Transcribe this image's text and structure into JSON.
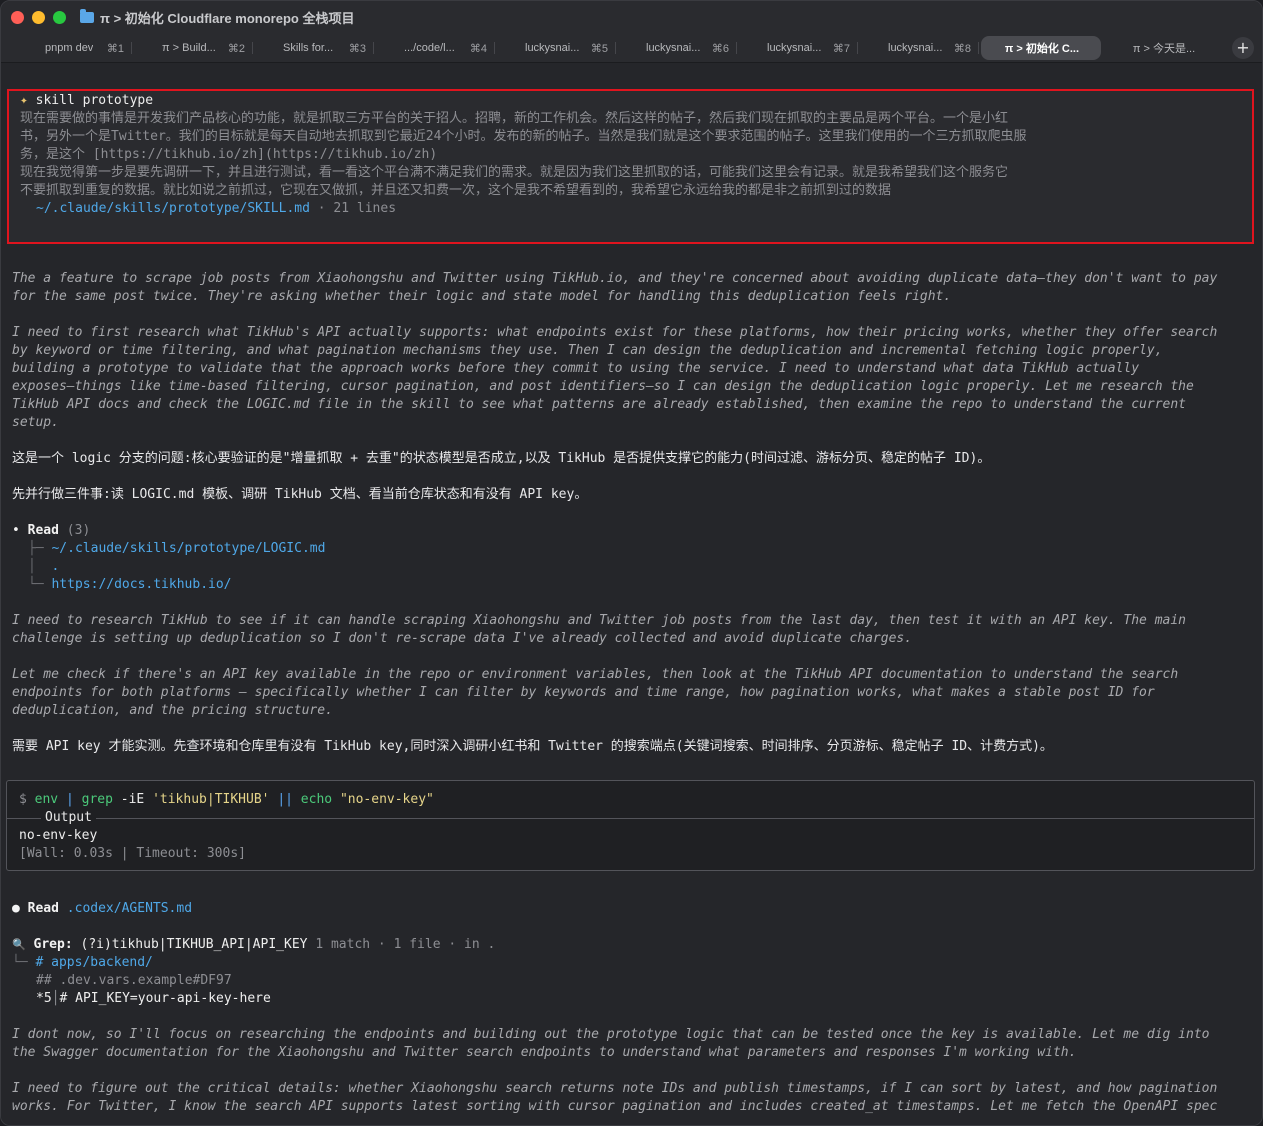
{
  "window": {
    "title": "π > 初始化 Cloudflare monorepo 全栈项目"
  },
  "tabs": [
    {
      "label": "pnpm dev",
      "key": "⌘1"
    },
    {
      "label": "π > Build...",
      "key": "⌘2"
    },
    {
      "label": "Skills for...",
      "key": "⌘3"
    },
    {
      "label": ".../code/l...",
      "key": "⌘4"
    },
    {
      "label": "luckysnai...",
      "key": "⌘5"
    },
    {
      "label": "luckysnai...",
      "key": "⌘6"
    },
    {
      "label": "luckysnai...",
      "key": "⌘7"
    },
    {
      "label": "luckysnai...",
      "key": "⌘8"
    },
    {
      "label": "π > 初始化 C...",
      "key": ""
    },
    {
      "label": "π > 今天是...",
      "key": ""
    }
  ],
  "add_tab": "+",
  "skill": {
    "star": "✦",
    "title": "skill prototype",
    "lines": [
      "现在需要做的事情是开发我们产品核心的功能，就是抓取三方平台的关于招人。招聘，新的工作机会。然后这样的帖子，然后我们现在抓取的主要品是两个平台。一个是小红",
      "书，另外一个是Twitter。我们的目标就是每天自动地去抓取到它最近24个小时。发布的新的帖子。当然是我们就是这个要求范围的帖子。这里我们使用的一个三方抓取爬虫服",
      "务，是这个 [https://tikhub.io/zh](https://tikhub.io/zh)",
      "现在我觉得第一步是要先调研一下，并且进行测试，看一看这个平台满不满足我们的需求。就是因为我们这里抓取的话，可能我们这里会有记录。就是我希望我们这个服务它",
      "不要抓取到重复的数据。就比如说之前抓过，它现在又做抓，并且还又扣费一次，这个是我不希望看到的，我希望它永远给我的都是非之前抓到过的数据"
    ],
    "file_path": "~/.claude/skills/prototype/SKILL.md",
    "file_meta": " · 21 lines"
  },
  "thinking_1": [
    "The a feature to scrape job posts from Xiaohongshu and Twitter using TikHub.io, and they're concerned about avoiding duplicate data—they don't want to pay",
    "for the same post twice. They're asking whether their logic and state model for handling this deduplication feels right."
  ],
  "thinking_2": [
    "I need to first research what TikHub's API actually supports: what endpoints exist for these platforms, how their pricing works, whether they offer search",
    "by keyword or time filtering, and what pagination mechanisms they use. Then I can design the deduplication and incremental fetching logic properly,",
    "building a prototype to validate that the approach works before they commit to using the service. I need to understand what data TikHub actually",
    "exposes—things like time-based filtering, cursor pagination, and post identifiers—so I can design the deduplication logic properly. Let me research the",
    "TikHub API docs and check the LOGIC.md file in the skill to see what patterns are already established, then examine the repo to understand the current",
    "setup."
  ],
  "answer_1": "这是一个 logic 分支的问题:核心要验证的是\"增量抓取 + 去重\"的状态模型是否成立,以及 TikHub 是否提供支撑它的能力(时间过滤、游标分页、稳定的帖子 ID)。",
  "answer_2": "先并行做三件事:读 LOGIC.md 模板、调研 TikHub 文档、看当前仓库状态和有没有 API key。",
  "read_group": {
    "bullet": "•",
    "label": "Read",
    "count": "(3)",
    "items": [
      {
        "tree": "├─",
        "text": "~/.claude/skills/prototype/LOGIC.md"
      },
      {
        "tree": "├─",
        "text": "."
      },
      {
        "tree": "└─",
        "text": "https://docs.tikhub.io/"
      }
    ],
    "tree_pipe": "│"
  },
  "thinking_3": [
    "I need to research TikHub to see if it can handle scraping Xiaohongshu and Twitter job posts from the last day, then test it with an API key. The main",
    "challenge is setting up deduplication so I don't re-scrape data I've already collected and avoid duplicate charges."
  ],
  "thinking_4": [
    "Let me check if there's an API key available in the repo or environment variables, then look at the TikHub API documentation to understand the search",
    "endpoints for both platforms — specifically whether I can filter by keywords and time range, how pagination works, what makes a stable post ID for",
    "deduplication, and the pricing structure."
  ],
  "answer_3": "需要 API key 才能实测。先查环境和仓库里有没有 TikHub key,同时深入调研小红书和 Twitter 的搜索端点(关键词搜索、时间排序、分页游标、稳定帖子 ID、计费方式)。",
  "command": {
    "prompt": "$",
    "cmd_env": "env",
    "pipe": "|",
    "cmd_grep": "grep",
    "flags": "-iE",
    "pattern": "'tikhub|TIKHUB'",
    "or": "||",
    "cmd_echo": "echo",
    "echo_arg": "\"no-env-key\"",
    "output_label": "Output",
    "output": "no-env-key",
    "meta": "[Wall: 0.03s | Timeout: 300s]"
  },
  "read_agents": {
    "bullet": "●",
    "label": "Read",
    "path": ".codex/AGENTS.md"
  },
  "grep": {
    "icon": "🔍",
    "label": "Grep:",
    "pattern": "(?i)tikhub|TIKHUB_API|API_KEY",
    "meta": "1 match · 1 file · in .",
    "tree": "└─",
    "result_path": "# apps/backend/",
    "result_sub": "## .dev.vars.example#DF97",
    "line_no": "*5",
    "line_sep": "│",
    "line_text": "# API_KEY=your-api-key-here"
  },
  "thinking_5": [
    "I dont now, so I'll focus on researching the endpoints and building out the prototype logic that can be tested once the key is available. Let me dig into",
    "the Swagger documentation for the Xiaohongshu and Twitter search endpoints to understand what parameters and responses I'm working with."
  ],
  "thinking_6": [
    "I need to figure out the critical details: whether Xiaohongshu search returns note IDs and publish timestamps, if I can sort by latest, and how pagination",
    "works. For Twitter, I know the search API supports latest sorting with cursor pagination and includes created_at timestamps. Let me fetch the OpenAPI spec"
  ]
}
